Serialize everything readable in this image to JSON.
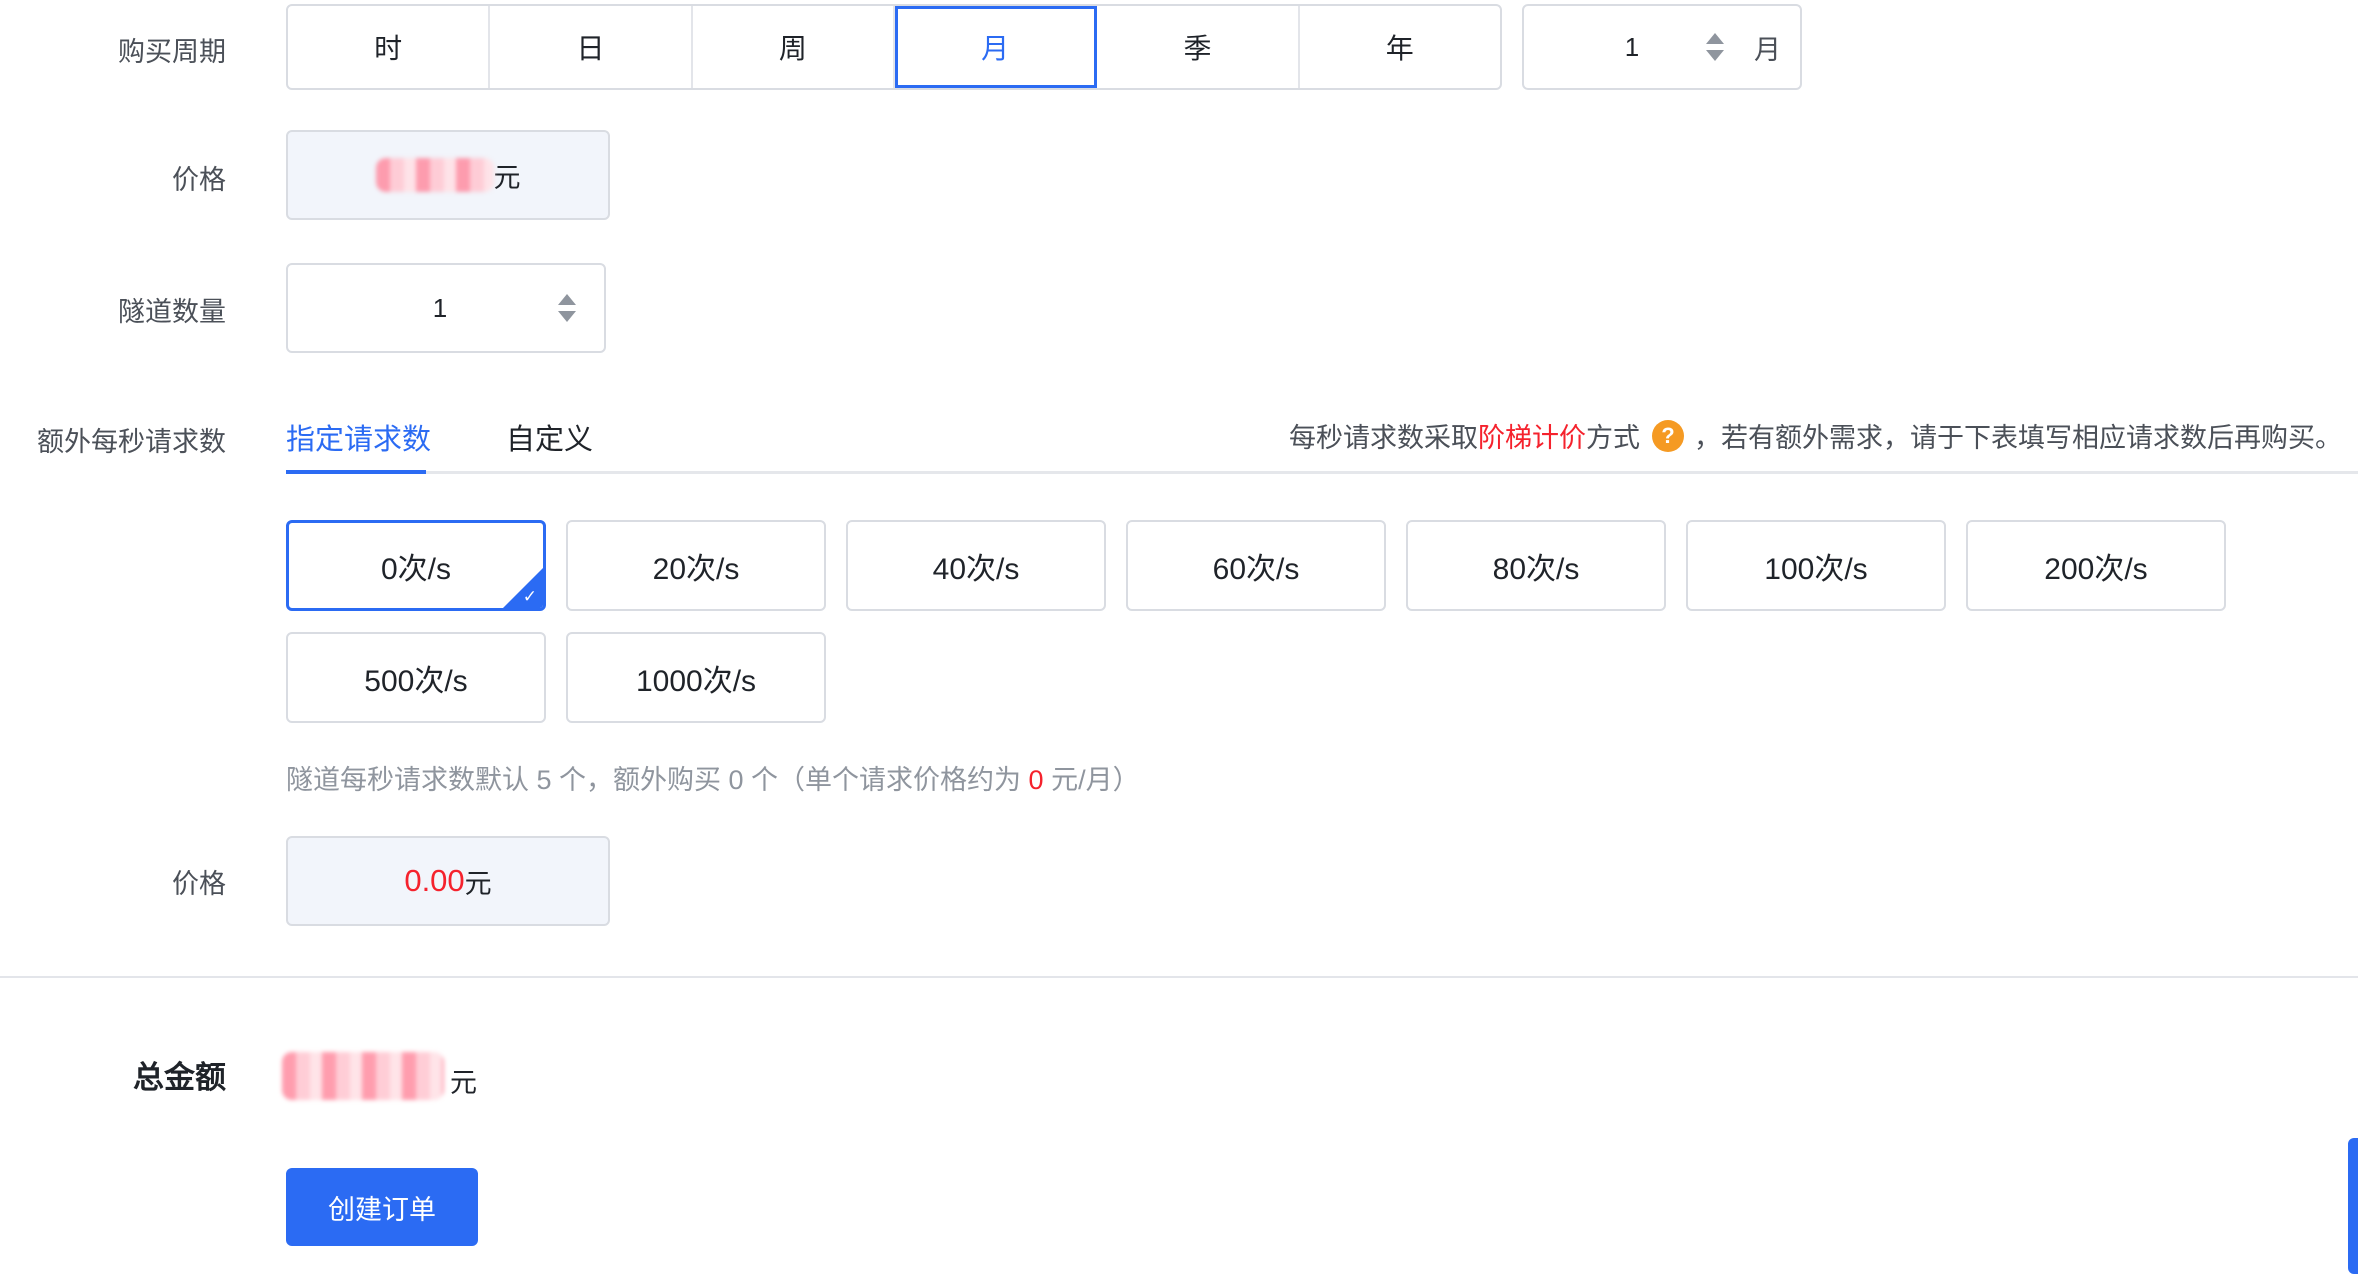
{
  "period": {
    "label": "购买周期",
    "options": [
      "时",
      "日",
      "周",
      "月",
      "季",
      "年"
    ],
    "selected": "月",
    "count": "1",
    "unit": "月"
  },
  "price": {
    "label": "价格",
    "unit": "元"
  },
  "tunnel": {
    "label": "隧道数量",
    "count": "1"
  },
  "rps": {
    "label": "额外每秒请求数",
    "tabs": [
      "指定请求数",
      "自定义"
    ],
    "active_tab": "指定请求数",
    "tip_prefix": "每秒请求数采取",
    "tip_highlight": "阶梯计价",
    "tip_middle": "方式",
    "tip_suffix": "，若有额外需求，请于下表填写相应请求数后再购买。",
    "help_icon": "question-icon",
    "options": [
      "0次/s",
      "20次/s",
      "40次/s",
      "60次/s",
      "80次/s",
      "100次/s",
      "200次/s",
      "500次/s",
      "1000次/s"
    ],
    "selected": "0次/s",
    "hint_pre": "隧道每秒请求数默认 5 个，额外购买 0 个（单个请求价格约为 ",
    "hint_value": "0",
    "hint_post": " 元/月）",
    "price_label": "价格",
    "price_value": "0.00",
    "price_unit": "元"
  },
  "total": {
    "label": "总金额",
    "unit": "元"
  },
  "create_button": "创建订单",
  "colors": {
    "accent": "#2b6bf3",
    "danger": "#f5222d",
    "warning": "#f59a23"
  }
}
